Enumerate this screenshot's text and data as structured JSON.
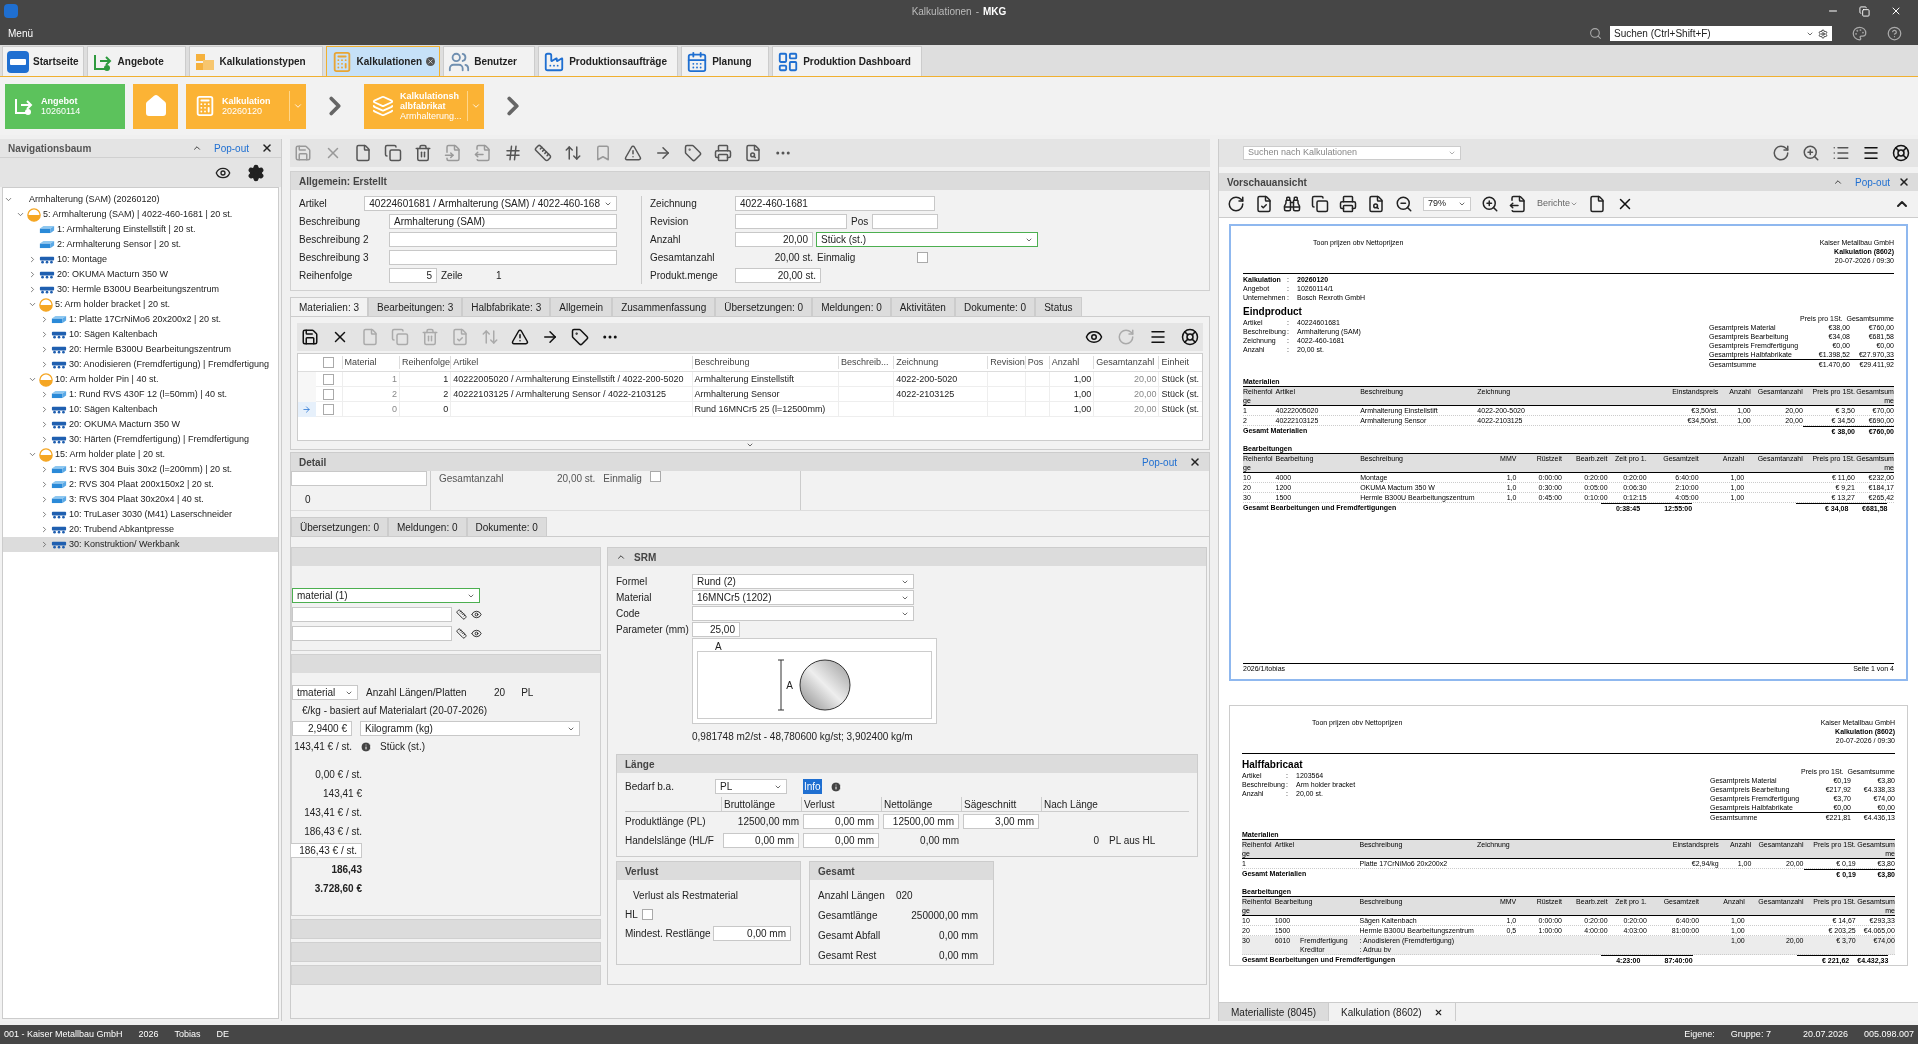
{
  "window": {
    "title": "Kalkulationen",
    "separator": "-",
    "app": "MKG"
  },
  "menu": "Menü",
  "global_search": {
    "placeholder": "Suchen (Ctrl+Shift+F)"
  },
  "tabs": [
    {
      "label": "Startseite",
      "selected": false,
      "closable": false
    },
    {
      "label": "Angebote",
      "selected": false,
      "closable": false
    },
    {
      "label": "Kalkulationstypen",
      "selected": false,
      "closable": false
    },
    {
      "label": "Kalkulationen",
      "selected": true,
      "closable": true
    },
    {
      "label": "Benutzer",
      "selected": false,
      "closable": false
    },
    {
      "label": "Produktionsaufträge",
      "selected": false,
      "closable": false
    },
    {
      "label": "Planung",
      "selected": false,
      "closable": false
    },
    {
      "label": "Produktion Dashboard",
      "selected": false,
      "closable": false
    }
  ],
  "breadcrumb": [
    {
      "kind": "card",
      "title": "Angebot",
      "subtitle": "10260114",
      "color": "#5cc25c",
      "dropdown": false
    },
    {
      "kind": "home",
      "color": "#fbb335"
    },
    {
      "kind": "card",
      "title": "Kalkulation",
      "subtitle": "20260120",
      "color": "#fbb335",
      "dropdown": true
    },
    {
      "kind": "chevron"
    },
    {
      "kind": "card",
      "title": "Kalkulationshalbfabrikat",
      "subtitle": "Armhalterung...",
      "color": "#fbb335",
      "dropdown": true
    },
    {
      "kind": "chevron"
    }
  ],
  "nav": {
    "title": "Navigationsbaum",
    "popout": "Pop-out",
    "tree": [
      {
        "label": "Armhalterung (SAM) (20260120)",
        "kind": "root",
        "expanded": true,
        "selected": false,
        "children": [
          {
            "label": "5: Armhalterung (SAM) | 4022-460-1681 | 20 st.",
            "kind": "semi",
            "expanded": true,
            "selected": false,
            "children": [
              {
                "label": "1: Armhalterung Einstellstift | 20 st.",
                "kind": "material",
                "selected": false
              },
              {
                "label": "2: Armhalterung Sensor | 20 st.",
                "kind": "material",
                "selected": false
              },
              {
                "label": "10: Montage",
                "kind": "operation",
                "expanded": false,
                "selected": false
              },
              {
                "label": "20: OKUMA Macturn 350 W",
                "kind": "operation",
                "expanded": false,
                "selected": false
              },
              {
                "label": "30: Hermle B300U Bearbeitungszentrum",
                "kind": "operation",
                "expanded": false,
                "selected": false
              },
              {
                "label": "5: Arm holder bracket | 20 st.",
                "kind": "semi",
                "expanded": true,
                "selected": false,
                "children": [
                  {
                    "label": "1: Platte 17CrNiMo6 20x200x2 | 20 st.",
                    "kind": "material",
                    "expanded": false,
                    "selected": false
                  },
                  {
                    "label": "10: Sägen Kaltenbach",
                    "kind": "operation",
                    "expanded": false,
                    "selected": false
                  },
                  {
                    "label": "20: Hermle B300U Bearbeitungszentrum",
                    "kind": "operation",
                    "expanded": false,
                    "selected": false
                  },
                  {
                    "label": "30: Anodisieren (Fremdfertigung) | Fremdfertigung",
                    "kind": "operation",
                    "expanded": false,
                    "selected": false
                  }
                ]
              },
              {
                "label": "10: Arm holder Pin | 40 st.",
                "kind": "semi",
                "expanded": true,
                "selected": false,
                "children": [
                  {
                    "label": "1: Rund RVS 430F 12 (l=50mm) | 40 st.",
                    "kind": "material",
                    "expanded": false,
                    "selected": false
                  },
                  {
                    "label": "10: Sägen Kaltenbach",
                    "kind": "operation",
                    "expanded": false,
                    "selected": false
                  },
                  {
                    "label": "20: OKUMA Macturn 350 W",
                    "kind": "operation",
                    "expanded": false,
                    "selected": false
                  },
                  {
                    "label": "30: Härten (Fremdfertigung) | Fremdfertigung",
                    "kind": "operation",
                    "expanded": false,
                    "selected": false
                  }
                ]
              },
              {
                "label": "15: Arm holder plate | 20 st.",
                "kind": "semi",
                "expanded": true,
                "selected": false,
                "children": [
                  {
                    "label": "1: RVS 304 Buis 30x2 (l=200mm) | 20 st.",
                    "kind": "material",
                    "expanded": false,
                    "selected": false
                  },
                  {
                    "label": "2: RVS 304 Plaat 200x150x2 | 20 st.",
                    "kind": "material",
                    "expanded": false,
                    "selected": false
                  },
                  {
                    "label": "3: RVS 304 Plaat 30x20x4 | 40 st.",
                    "kind": "material",
                    "expanded": false,
                    "selected": false
                  },
                  {
                    "label": "10: TruLaser 3030 (M41) Laserschneider",
                    "kind": "operation",
                    "expanded": false,
                    "selected": false
                  },
                  {
                    "label": "20: Trubend Abkantpresse",
                    "kind": "operation",
                    "expanded": false,
                    "selected": false
                  },
                  {
                    "label": "30: Konstruktion/ Werkbank",
                    "kind": "operation",
                    "expanded": false,
                    "selected": true
                  }
                ]
              }
            ]
          }
        ]
      }
    ]
  },
  "search_calc": {
    "placeholder": "Suchen nach Kalkulationen"
  },
  "general": {
    "title": "Allgemein: Erstellt",
    "artikel": {
      "label": "Artikel",
      "value": "40224601681 / Armhalterung (SAM) / 4022-460-168"
    },
    "beschreibung": {
      "label": "Beschreibung",
      "value": "Armhalterung (SAM)"
    },
    "beschreibung2": {
      "label": "Beschreibung 2"
    },
    "beschreibung3": {
      "label": "Beschreibung 3"
    },
    "reihenfolge": {
      "label": "Reihenfolge",
      "value": "5"
    },
    "zeile": {
      "label": "Zeile",
      "value": "1"
    },
    "zeichnung": {
      "label": "Zeichnung",
      "value": "4022-460-1681"
    },
    "revision": {
      "label": "Revision"
    },
    "pos": {
      "label": "Pos"
    },
    "anzahl": {
      "label": "Anzahl",
      "value": "20,00",
      "unit": "Stück (st.)"
    },
    "gesamtanzahl": {
      "label": "Gesamtanzahl",
      "value": "20,00 st."
    },
    "einmalig": {
      "label": "Einmalig",
      "checked": false
    },
    "produktmenge": {
      "label": "Produkt.menge",
      "value": "20,00 st."
    }
  },
  "subtabs": [
    {
      "label": "Materialien: 3",
      "selected": true
    },
    {
      "label": "Bearbeitungen: 3",
      "selected": false
    },
    {
      "label": "Halbfabrikate: 3",
      "selected": false
    },
    {
      "label": "Allgemein",
      "selected": false
    },
    {
      "label": "Zusammenfassung",
      "selected": false
    },
    {
      "label": "Übersetzungen: 0",
      "selected": false
    },
    {
      "label": "Meldungen: 0",
      "selected": false
    },
    {
      "label": "Aktivitäten",
      "selected": false
    },
    {
      "label": "Dokumente: 0",
      "selected": false
    },
    {
      "label": "Status",
      "selected": false
    }
  ],
  "materials_table": {
    "all_checked": false,
    "columns": [
      "Material",
      "Reihenfolge",
      "Artikel",
      "Beschreibung",
      "Beschreib...",
      "Zeichnung",
      "Revision",
      "Pos",
      "Anzahl",
      "Gesamtanzahl",
      "Einheit"
    ],
    "rows": [
      {
        "material": "1",
        "reihenfolge": "1",
        "artikel": "40222005020 / Armhalterung Einstellstift / 4022-200-5020",
        "beschreibung": "Armhalterung Einstellstift",
        "zeichnung": "4022-200-5020",
        "anzahl": "1,00",
        "gesamtanzahl": "20,00",
        "einheit": "Stück (st.",
        "checked": false,
        "current": false
      },
      {
        "material": "2",
        "reihenfolge": "2",
        "artikel": "40222103125 / Armhalterung Sensor / 4022-2103125",
        "beschreibung": "Armhalterung Sensor",
        "zeichnung": "4022-2103125",
        "anzahl": "1,00",
        "gesamtanzahl": "20,00",
        "einheit": "Stück (st.",
        "checked": false,
        "current": false
      },
      {
        "material": "0",
        "reihenfolge": "0",
        "beschreibung": "Rund 16MNCr5 25 (l=12500mm)",
        "anzahl": "1,00",
        "gesamtanzahl": "20,00",
        "einheit": "Stück (st.",
        "checked": false,
        "current": true
      }
    ]
  },
  "detail": {
    "title": "Detail",
    "popout": "Pop-out",
    "top": {
      "gesamtanzahl_label": "Gesamtanzahl",
      "gesamtanzahl": "20,00 st.",
      "einmalig_label": "Einmalig",
      "einmalig_checked": false,
      "zero": "0"
    },
    "subtabs": [
      {
        "label": "Übersetzungen: 0",
        "selected": false
      },
      {
        "label": "Meldungen: 0",
        "selected": false
      },
      {
        "label": "Dokumente: 0",
        "selected": false
      }
    ],
    "left": {
      "material_select": "material (1)",
      "rest_select": "tmaterial",
      "anzahl_label": "Anzahl Längen/Platten",
      "anzahl": "20",
      "anzahl_unit": "PL",
      "price_note": "€/kg - basiert auf Materialart (20-07-2026)",
      "price": "2,9400 €",
      "price_unit": "Kilogramm (kg)",
      "per_piece": "143,41 € / st.",
      "piece_unit": "Stück (st.)",
      "values": [
        {
          "text": "0,00 € / st.",
          "kind": "plain"
        },
        {
          "text": "143,41 €",
          "kind": "plain"
        },
        {
          "text": "143,41 € / st.",
          "kind": "plain"
        },
        {
          "text": "186,43 € / st.",
          "kind": "plain"
        },
        {
          "text": "186,43 € / st.",
          "kind": "input"
        },
        {
          "text": "186,43",
          "kind": "bold"
        },
        {
          "text": "3.728,60 €",
          "kind": "bold"
        }
      ]
    },
    "srm": {
      "title": "SRM",
      "expanded": true,
      "formel_label": "Formel",
      "formel": "Rund (2)",
      "material_label": "Material",
      "material": "16MNCr5 (1202)",
      "code_label": "Code",
      "param_label": "Parameter (mm)",
      "param": "25,00",
      "dim_label": "A",
      "dim_label_side": "A",
      "result": "0,981748 m2/st - 48,780600 kg/st; 3,902400 kg/m"
    },
    "laenge": {
      "title": "Länge",
      "bedarf_label": "Bedarf b.a.",
      "bedarf": "PL",
      "info": "Info",
      "info_highlighted": true,
      "columns": [
        "Bruttolänge",
        "Verlust",
        "Nettolänge",
        "Sägeschnitt",
        "Nach Länge"
      ],
      "rows": [
        {
          "label": "Produktlänge (PL)",
          "cells": [
            {
              "text": "12500,00 mm",
              "kind": "plain"
            },
            {
              "text": "0,00 mm",
              "kind": "input"
            },
            {
              "text": "12500,00 mm",
              "kind": "input"
            },
            {
              "text": "3,00 mm",
              "kind": "input"
            }
          ]
        },
        {
          "label": "Handelslänge (HL/F",
          "cells": [
            {
              "text": "0,00 mm",
              "kind": "input"
            },
            {
              "text": "0,00 mm",
              "kind": "input"
            },
            {
              "text": "0,00 mm",
              "kind": "plain"
            }
          ],
          "nach_laenge": "0",
          "suffix": "PL aus HL"
        }
      ]
    },
    "verlust": {
      "title": "Verlust",
      "rest_label": "Verlust als Restmaterial",
      "hl_label": "HL",
      "hl_checked": false,
      "min_label": "Mindest. Restlänge",
      "min": "0,00 mm"
    },
    "gesamt": {
      "title": "Gesamt",
      "rows": [
        {
          "label": "Anzahl Längen",
          "value": "020"
        },
        {
          "label": "Gesamtlänge",
          "value": "250000,00 mm"
        },
        {
          "label": "Gesamt Abfall",
          "value": "0,00 mm"
        },
        {
          "label": "Gesamt Rest",
          "value": "0,00 mm"
        }
      ]
    }
  },
  "preview": {
    "title": "Vorschauansicht",
    "popout": "Pop-out",
    "zoom": "79%",
    "reports": "Berichte",
    "pages": [
      {
        "selected": true,
        "separator": ":",
        "note": "Toon prijzen obv Nettoprijzen",
        "company": "Kaiser Metallbau GmbH",
        "doc": "Kalkulation (8602)",
        "date": "20-07-2026 / 09:30",
        "meta": [
          {
            "label": "Kalkulation",
            "value": "20260120",
            "bold": true
          },
          {
            "label": "Angebot",
            "value": "10260114/1",
            "bold": false
          },
          {
            "label": "Unternehmen",
            "value": "Bosch Rexroth GmbH",
            "bold": false
          }
        ],
        "product_title": "Eindproduct",
        "product": [
          {
            "label": "Artikel",
            "value": "40224601681"
          },
          {
            "label": "Beschreibung",
            "value": "Armhalterung (SAM)"
          },
          {
            "label": "Zeichnung",
            "value": "4022-460-1681"
          },
          {
            "label": "Anzahl",
            "value": "20,00 st."
          }
        ],
        "summary_head": [
          "Preis pro 1St.",
          "Gesamtsumme"
        ],
        "summary": [
          {
            "label": "Gesamtpreis Material",
            "a": "€38,00",
            "b": "€760,00"
          },
          {
            "label": "Gesamtpreis Bearbeitung",
            "a": "€34,08",
            "b": "€681,58"
          },
          {
            "label": "Gesamtpreis Fremdfertigung",
            "a": "€0,00",
            "b": "€0,00"
          },
          {
            "label": "Gesamtpreis Halbfabrikate",
            "a": "€1.398,52",
            "b": "€27.970,33"
          },
          {
            "label": "Gesamtsumme",
            "a": "€1.470,60",
            "b": "€29.411,92"
          }
        ],
        "sections": [
          {
            "kind": "materials",
            "title": "Materialien",
            "columns": [
              "Reihenfolge",
              "Artikel",
              "Beschreibung",
              "Zeichnung",
              "Einstandspreis",
              "Anzahl",
              "Gesamtanzahl",
              "Preis pro 1St.",
              "Gesamtsumme"
            ],
            "rows": [
              {
                "r": "1",
                "a": "40222005020",
                "b": "Armhalterung Einstellstift",
                "z": "4022-200-5020",
                "e": "€3,50/st.",
                "n": "1,00",
                "g": "20,00",
                "p": "€ 3,50",
                "s": "€70,00"
              },
              {
                "r": "2",
                "a": "40222103125",
                "b": "Armhalterung Sensor",
                "z": "4022-2103125",
                "e": "€34,50/st.",
                "n": "1,00",
                "g": "20,00",
                "p": "€ 34,50",
                "s": "€690,00"
              }
            ],
            "total": {
              "label": "Gesamt Materialien",
              "p": "€ 38,00",
              "s": "€760,00"
            }
          },
          {
            "kind": "operations",
            "title": "Bearbeitungen",
            "columns": [
              "Reihenfolge",
              "Bearbeitung",
              "Beschreibung",
              "MMV",
              "Rüstzeit",
              "Bearb.zeit",
              "Zeit pro 1.",
              "Gesamtzeit",
              "Anzahl",
              "Gesamtanzahl",
              "Preis pro 1St.",
              "Gesamtsumme"
            ],
            "rows": [
              {
                "r": "10",
                "a": "4000",
                "b": "Montage",
                "m": "1,0",
                "ru": "0:00:00",
                "bz": "0:20:00",
                "zp": "0:20:00",
                "gz": "6:40:00",
                "n": "1,00",
                "p": "€ 11,60",
                "s": "€232,00"
              },
              {
                "r": "20",
                "a": "1200",
                "b": "OKUMA Macturn 350 W",
                "m": "1,0",
                "ru": "0:30:00",
                "bz": "0:05:00",
                "zp": "0:06:30",
                "gz": "2:10:00",
                "n": "1,00",
                "p": "€ 9,21",
                "s": "€184,17"
              },
              {
                "r": "30",
                "a": "1500",
                "b": "Hermle B300U Bearbeitungszentrum",
                "m": "1,0",
                "ru": "0:45:00",
                "bz": "0:10:00",
                "zp": "0:12:15",
                "gz": "4:05:00",
                "n": "1,00",
                "p": "€ 13,27",
                "s": "€265,42"
              }
            ],
            "total": {
              "label": "Gesamt Bearbeitungen und Fremdfertigungen",
              "zp": "0:38:45",
              "gz": "12:55:00",
              "p": "€ 34,08",
              "s": "€681,58"
            }
          }
        ],
        "footer_left": "2026/1/tobias",
        "footer_right": "Seite 1 von 4"
      },
      {
        "selected": false,
        "separator": ":",
        "note": "Toon prijzen obv Nettoprijzen",
        "company": "Kaiser Metallbau GmbH",
        "doc": "Kalkulation (8602)",
        "date": "20-07-2026 / 09:30",
        "product_title": "Halffabricaat",
        "product": [
          {
            "label": "Artikel",
            "value": "1203564"
          },
          {
            "label": "Beschreibung",
            "value": "Arm holder bracket"
          },
          {
            "label": "Anzahl",
            "value": "20,00 st."
          }
        ],
        "summary_head": [
          "Preis pro 1St.",
          "Gesamtsumme"
        ],
        "summary": [
          {
            "label": "Gesamtpreis Material",
            "a": "€0,19",
            "b": "€3,80"
          },
          {
            "label": "Gesamtpreis Bearbeitung",
            "a": "€217,92",
            "b": "€4.338,33"
          },
          {
            "label": "Gesamtpreis Fremdfertigung",
            "a": "€3,70",
            "b": "€74,00"
          },
          {
            "label": "Gesamtpreis Halbfabrikate",
            "a": "€0,00",
            "b": "€0,00"
          },
          {
            "label": "Gesamtsumme",
            "a": "€221,81",
            "b": "€4.436,13"
          }
        ],
        "sections": [
          {
            "kind": "materials",
            "title": "Materialien",
            "columns": [
              "Reihenfolge",
              "Artikel",
              "Beschreibung",
              "Zeichnung",
              "Einstandspreis",
              "Anzahl",
              "Gesamtanzahl",
              "Preis pro 1St.",
              "Gesamtsumme"
            ],
            "rows": [
              {
                "r": "1",
                "b": "Platte 17CrNiMo6 20x200x2",
                "e": "€2,94/kg",
                "n": "1,00",
                "g": "20,00",
                "p": "€ 0,19",
                "s": "€3,80"
              }
            ],
            "total": {
              "label": "Gesamt Materialien",
              "p": "€ 0,19",
              "s": "€3,80"
            }
          },
          {
            "kind": "operations",
            "title": "Bearbeitungen",
            "columns": [
              "Reihenfolge",
              "Bearbeitung",
              "Beschreibung",
              "MMV",
              "Rüstzeit",
              "Bearb.zeit",
              "Zeit pro 1.",
              "Gesamtzeit",
              "Anzahl",
              "Gesamtanzahl",
              "Preis pro 1St.",
              "Gesamtsumme"
            ],
            "rows": [
              {
                "r": "10",
                "a": "1000",
                "b": "Sägen Kaltenbach",
                "m": "1,0",
                "ru": "0:00:00",
                "bz": "0:20:00",
                "zp": "0:20:00",
                "gz": "6:40:00",
                "n": "1,00",
                "p": "€ 14,67",
                "s": "€293,33"
              },
              {
                "r": "20",
                "a": "1500",
                "b": "Hermle B300U Bearbeitungszentrum",
                "m": "0,5",
                "ru": "1:00:00",
                "bz": "4:00:00",
                "zp": "4:03:00",
                "gz": "81:00:00",
                "n": "1,00",
                "p": "€ 203,25",
                "s": "€4.065,00"
              },
              {
                "r": "30",
                "a": "6010",
                "extra": "Fremdfertigung",
                "b": ": Anodisieren (Fremdfertigung)",
                "extra2": "Kreditor",
                "b2": ": Adruu bv",
                "n": "1,00",
                "g": "20,00",
                "p": "€ 3,70",
                "s": "€74,00"
              }
            ],
            "total": {
              "label": "Gesamt Bearbeitungen und Fremdfertigungen",
              "zp": "4:23:00",
              "gz": "87:40:00",
              "p": "€ 221,62",
              "s": "€4.432,33"
            }
          }
        ]
      }
    ],
    "bottom_tabs": [
      {
        "label": "Materialliste (8045)",
        "selected": false,
        "closable": false
      },
      {
        "label": "Kalkulation (8602)",
        "selected": true,
        "closable": true
      }
    ]
  },
  "status_bar": {
    "company": "001 - Kaiser Metallbau GmbH",
    "year": "2026",
    "user": "Tobias",
    "lang": "DE",
    "own": "Eigene:",
    "group": "Gruppe: 7",
    "date": "20.07.2026",
    "version": "005.098.007"
  }
}
